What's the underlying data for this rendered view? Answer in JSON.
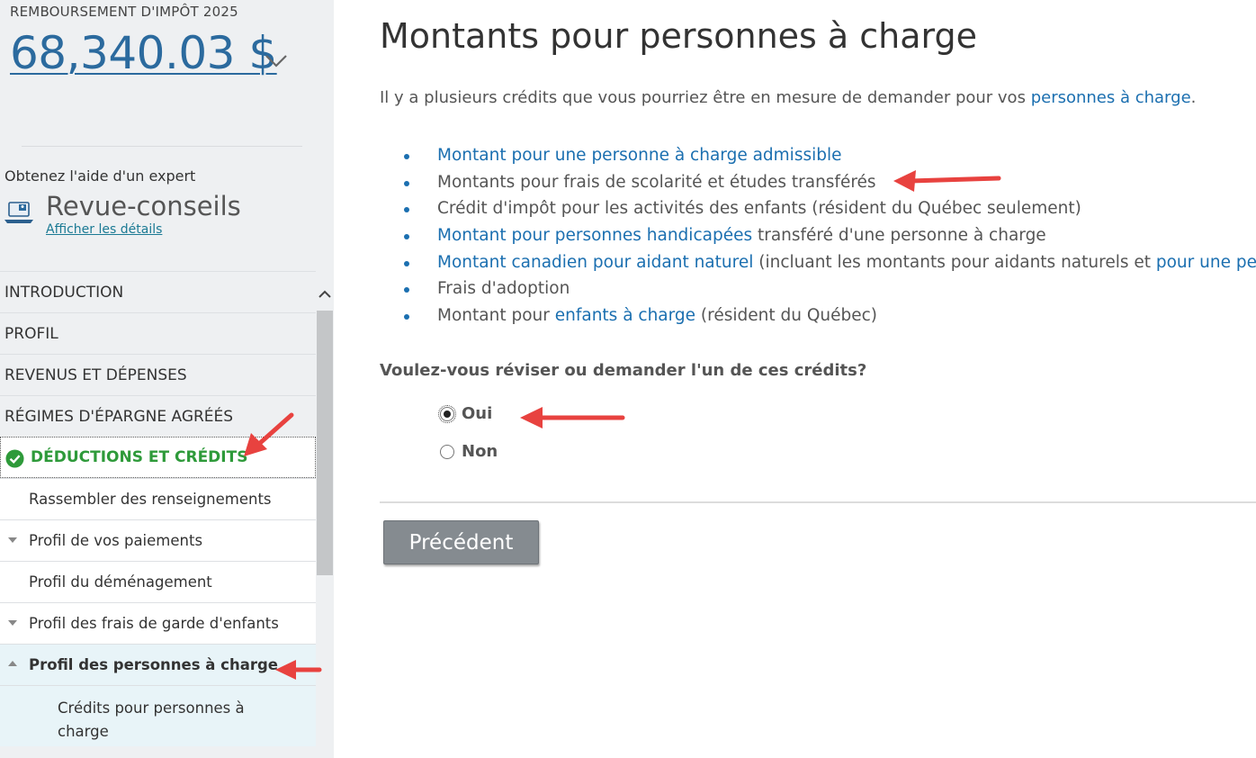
{
  "sidebar": {
    "refund_label": "REMBOURSEMENT D'IMPÔT 2025",
    "refund_amount": "68,340.03 $",
    "expert_label": "Obtenez l'aide d'un expert",
    "review_title": "Revue-conseils",
    "details_link": "Afficher les détails",
    "nav": {
      "introduction": "INTRODUCTION",
      "profil": "PROFIL",
      "revenus": "REVENUS ET DÉPENSES",
      "regimes": "RÉGIMES D'ÉPARGNE AGRÉÉS",
      "deductions": "DÉDUCTIONS ET CRÉDITS",
      "rassembler": "Rassembler des renseignements",
      "paiements": "Profil de vos paiements",
      "demenagement": "Profil du déménagement",
      "garde": "Profil des frais de garde d'enfants",
      "personnes": "Profil des personnes à charge",
      "credits_personnes": "Crédits pour personnes à charge"
    }
  },
  "main": {
    "title": "Montants pour personnes à charge",
    "intro_text": "Il y a plusieurs crédits que vous pourriez être en mesure de demander pour vos ",
    "intro_link": "personnes à charge",
    "intro_end": ".",
    "items": {
      "i1_link": "Montant pour une personne à charge admissible",
      "i2_text": "Montants pour frais de scolarité et études transférés",
      "i3_text": "Crédit d'impôt pour les activités des enfants (résident du Québec seulement)",
      "i4_link": "Montant pour personnes handicapées",
      "i4_text": " transféré d'une personne à charge",
      "i5_link": "Montant canadien pour aidant naturel",
      "i5_text": " (incluant les montants pour aidants naturels et ",
      "i5_link2": "pour une pe",
      "i6_text": "Frais d'adoption",
      "i7_text1": "Montant pour ",
      "i7_link": "enfants à charge",
      "i7_text2": " (résident du Québec)"
    },
    "question": "Voulez-vous réviser ou demander l'un de ces crédits?",
    "option_yes": "Oui",
    "option_no": "Non",
    "selected_option": "Oui",
    "prev_button": "Précédent"
  },
  "colors": {
    "link": "#1b6fb0",
    "active_nav": "#2e9a3a",
    "annotation_arrow": "#e8423f",
    "button_bg": "#858b90"
  }
}
